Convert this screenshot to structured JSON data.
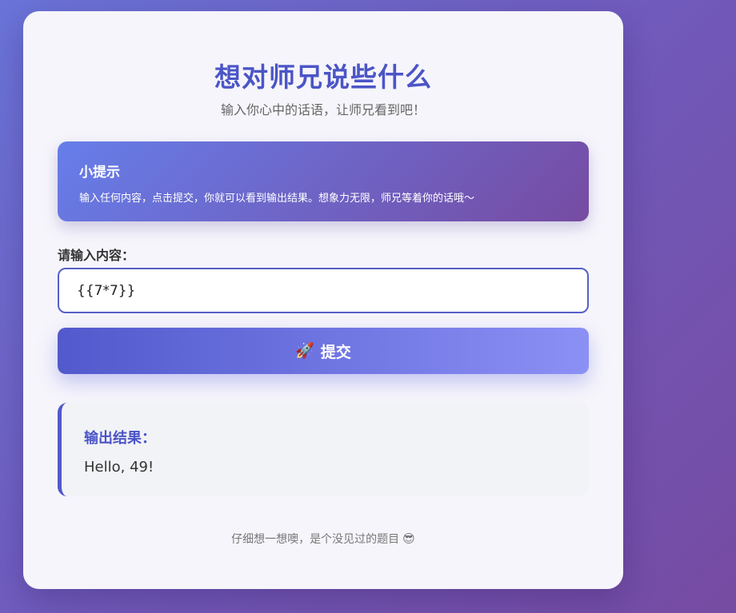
{
  "header": {
    "title": "想对师兄说些什么",
    "subtitle": "输入你心中的话语，让师兄看到吧！"
  },
  "tip": {
    "title": "小提示",
    "text": "输入任何内容，点击提交，你就可以看到输出结果。想象力无限，师兄等着你的话哦～"
  },
  "form": {
    "label": "请输入内容：",
    "input_value": "{{7*7}}",
    "submit_icon": "🚀",
    "submit_label": "提交"
  },
  "result": {
    "label": "输出结果：",
    "text": "Hello, 49!"
  },
  "footer": {
    "text": "仔细想一想噢，是个没见过的题目",
    "icon": "😎"
  },
  "colors": {
    "accent": "#4b55c6",
    "background_start": "#667eea",
    "background_end": "#764ba2",
    "button_start": "#5159cc",
    "button_end": "#8b90f5"
  }
}
